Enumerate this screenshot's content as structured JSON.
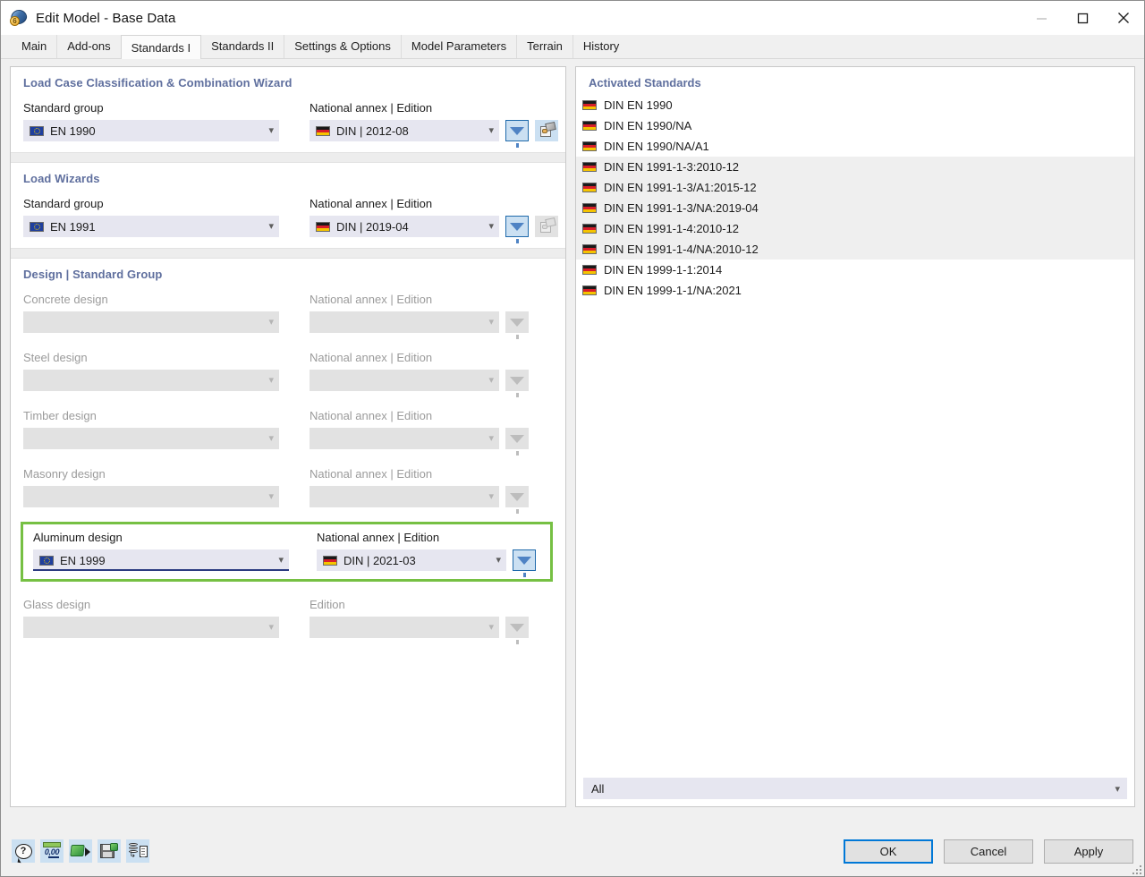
{
  "window": {
    "title": "Edit Model - Base Data",
    "app_icon": "model-disc-icon",
    "controls": {
      "minimize": "minimize-icon",
      "maximize": "maximize-icon",
      "close": "close-icon"
    }
  },
  "tabs": [
    {
      "label": "Main",
      "active": false
    },
    {
      "label": "Add-ons",
      "active": false
    },
    {
      "label": "Standards I",
      "active": true
    },
    {
      "label": "Standards II",
      "active": false
    },
    {
      "label": "Settings & Options",
      "active": false
    },
    {
      "label": "Model Parameters",
      "active": false
    },
    {
      "label": "Terrain",
      "active": false
    },
    {
      "label": "History",
      "active": false
    }
  ],
  "left_panel": {
    "sections": [
      {
        "title": "Load Case Classification & Combination Wizard",
        "left_label": "Standard group",
        "left_value": "EN 1990",
        "left_flag": "eu-flag-icon",
        "right_label": "National annex | Edition",
        "right_value": "DIN | 2012-08",
        "right_flag": "de-flag-icon",
        "filter_enabled": true,
        "wizard_enabled": true
      },
      {
        "title": "Load Wizards",
        "left_label": "Standard group",
        "left_value": "EN 1991",
        "left_flag": "eu-flag-icon",
        "right_label": "National annex | Edition",
        "right_value": "DIN | 2019-04",
        "right_flag": "de-flag-icon",
        "filter_enabled": true,
        "wizard_enabled": false
      }
    ],
    "design_section": {
      "title": "Design | Standard Group",
      "rows": [
        {
          "left_label": "Concrete design",
          "left_value": "",
          "right_label": "National annex | Edition",
          "right_value": "",
          "enabled": false,
          "highlighted": false
        },
        {
          "left_label": "Steel design",
          "left_value": "",
          "right_label": "National annex | Edition",
          "right_value": "",
          "enabled": false,
          "highlighted": false
        },
        {
          "left_label": "Timber design",
          "left_value": "",
          "right_label": "National annex | Edition",
          "right_value": "",
          "enabled": false,
          "highlighted": false
        },
        {
          "left_label": "Masonry design",
          "left_value": "",
          "right_label": "National annex | Edition",
          "right_value": "",
          "enabled": false,
          "highlighted": false
        },
        {
          "left_label": "Aluminum design",
          "left_value": "EN 1999",
          "left_flag": "eu-flag-icon",
          "right_label": "National annex | Edition",
          "right_value": "DIN | 2021-03",
          "right_flag": "de-flag-icon",
          "enabled": true,
          "highlighted": true
        },
        {
          "left_label": "Glass design",
          "left_value": "",
          "right_label": "Edition",
          "right_value": "",
          "enabled": false,
          "highlighted": false
        }
      ]
    }
  },
  "right_panel": {
    "title": "Activated Standards",
    "items": [
      {
        "label": "DIN EN 1990",
        "flag": "de-flag-icon",
        "banded": false
      },
      {
        "label": "DIN EN 1990/NA",
        "flag": "de-flag-icon",
        "banded": false
      },
      {
        "label": "DIN EN 1990/NA/A1",
        "flag": "de-flag-icon",
        "banded": false
      },
      {
        "label": "DIN EN 1991-1-3:2010-12",
        "flag": "de-flag-icon",
        "banded": true
      },
      {
        "label": "DIN EN 1991-1-3/A1:2015-12",
        "flag": "de-flag-icon",
        "banded": true
      },
      {
        "label": "DIN EN 1991-1-3/NA:2019-04",
        "flag": "de-flag-icon",
        "banded": true
      },
      {
        "label": "DIN EN 1991-1-4:2010-12",
        "flag": "de-flag-icon",
        "banded": true
      },
      {
        "label": "DIN EN 1991-1-4/NA:2010-12",
        "flag": "de-flag-icon",
        "banded": true
      },
      {
        "label": "DIN EN 1999-1-1:2014",
        "flag": "de-flag-icon",
        "banded": false
      },
      {
        "label": "DIN EN 1999-1-1/NA:2021",
        "flag": "de-flag-icon",
        "banded": false
      }
    ],
    "filter_select": "All"
  },
  "footer": {
    "tools": [
      {
        "name": "help-icon",
        "title": "Help"
      },
      {
        "name": "units-icon",
        "title": "0,00"
      },
      {
        "name": "export-icon",
        "title": "Export"
      },
      {
        "name": "save-icon",
        "title": "Save"
      },
      {
        "name": "database-report-icon",
        "title": "Report"
      }
    ],
    "units_value": "0,00",
    "help_glyph": "?",
    "buttons": {
      "ok": "OK",
      "cancel": "Cancel",
      "apply": "Apply"
    }
  },
  "colors": {
    "accent_blue": "#0078d7",
    "section_header": "#5f6f9e",
    "highlight_green": "#76c043",
    "field_bg": "#e6e6f0",
    "disabled_bg": "#e2e2e2",
    "band_gray": "#efefef"
  }
}
